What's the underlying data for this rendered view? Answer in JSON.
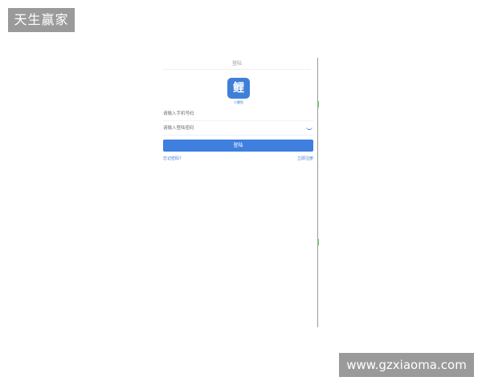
{
  "watermarks": {
    "top_left": "天生赢家",
    "bottom_right": "www.gzxiaoma.com"
  },
  "login": {
    "nav_title": "登陆",
    "logo_char": "鲤",
    "logo_caption": "小鲤鱼",
    "phone_placeholder": "请输入手机号码",
    "password_placeholder": "请输入登陆密码",
    "login_button": "登陆",
    "forgot_link": "忘记密码?",
    "register_link": "立即注册"
  },
  "colors": {
    "accent": "#3e7fe0",
    "watermark_bg": "#9a9a9a"
  }
}
